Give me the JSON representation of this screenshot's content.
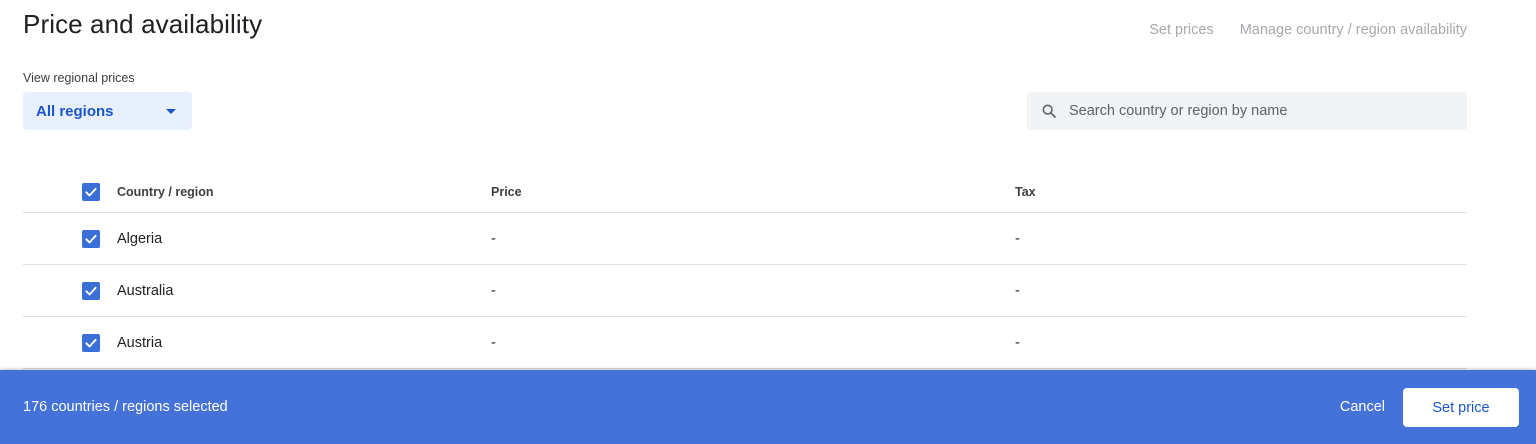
{
  "header": {
    "title": "Price and availability",
    "actions": [
      "Set prices",
      "Manage country / region availability"
    ]
  },
  "region_filter": {
    "label": "View regional prices",
    "selected": "All regions"
  },
  "search": {
    "placeholder": "Search country or region by name",
    "value": ""
  },
  "table": {
    "columns": [
      "Country / region",
      "Price",
      "Tax"
    ],
    "header_checked": true,
    "rows": [
      {
        "country": "Algeria",
        "price": "-",
        "tax": "-",
        "checked": true
      },
      {
        "country": "Australia",
        "price": "-",
        "tax": "-",
        "checked": true
      },
      {
        "country": "Austria",
        "price": "-",
        "tax": "-",
        "checked": true
      }
    ]
  },
  "footer": {
    "selection_text": "176 countries / regions selected",
    "cancel_label": "Cancel",
    "set_price_label": "Set price"
  },
  "colors": {
    "accent": "#4572d9",
    "checkbox": "#3b6fd8",
    "select_bg": "#e8f0fe",
    "link_blue": "#1a56c9"
  },
  "icons": {
    "search": "search-icon",
    "dropdown": "caret-down-icon",
    "checkbox": "check-icon"
  }
}
